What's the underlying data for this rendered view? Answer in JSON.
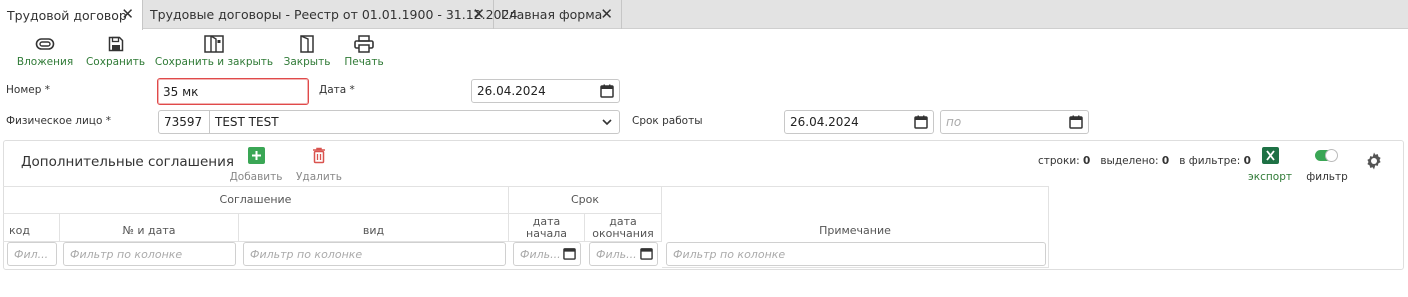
{
  "tabs": [
    {
      "label": "Трудовой договор",
      "active": true
    },
    {
      "label": "Трудовые договоры - Реестр от 01.01.1900 - 31.12.2024",
      "active": false
    },
    {
      "label": "Главная форма",
      "active": false
    }
  ],
  "toolbar": {
    "attachments": "Вложения",
    "save": "Сохранить",
    "save_close": "Сохранить и закрыть",
    "close": "Закрыть",
    "print": "Печать"
  },
  "form": {
    "number_label": "Номер *",
    "number_value": "35 мк",
    "date_label": "Дата *",
    "date_value": "26.04.2024",
    "person_label": "Физическое лицо *",
    "person_code": "73597",
    "person_name": "TEST TEST",
    "term_label": "Срок работы",
    "term_from": "26.04.2024",
    "term_to_placeholder": "по"
  },
  "agreements": {
    "title": "Дополнительные соглашения",
    "add": "Добавить",
    "delete": "Удалить",
    "rows_label": "строки:",
    "rows_value": "0",
    "selected_label": "выделено:",
    "selected_value": "0",
    "filtered_label": "в фильтре:",
    "filtered_value": "0",
    "export": "экспорт",
    "filter": "фильтр",
    "group_agreement": "Соглашение",
    "group_term": "Срок",
    "col_code": "код",
    "col_num_date": "№ и дата",
    "col_type": "вид",
    "col_start_l1": "дата",
    "col_start_l2": "начала",
    "col_end_l1": "дата",
    "col_end_l2": "окончания",
    "col_note": "Примечание",
    "filter_short": "Фил...",
    "filter_date": "Филь...",
    "filter_full": "Фильтр по колонке"
  },
  "colors": {
    "accent_green": "#2f7a36",
    "error_red": "#e04a4a",
    "delete_red": "#d9534f",
    "excel_green": "#1e7145"
  }
}
